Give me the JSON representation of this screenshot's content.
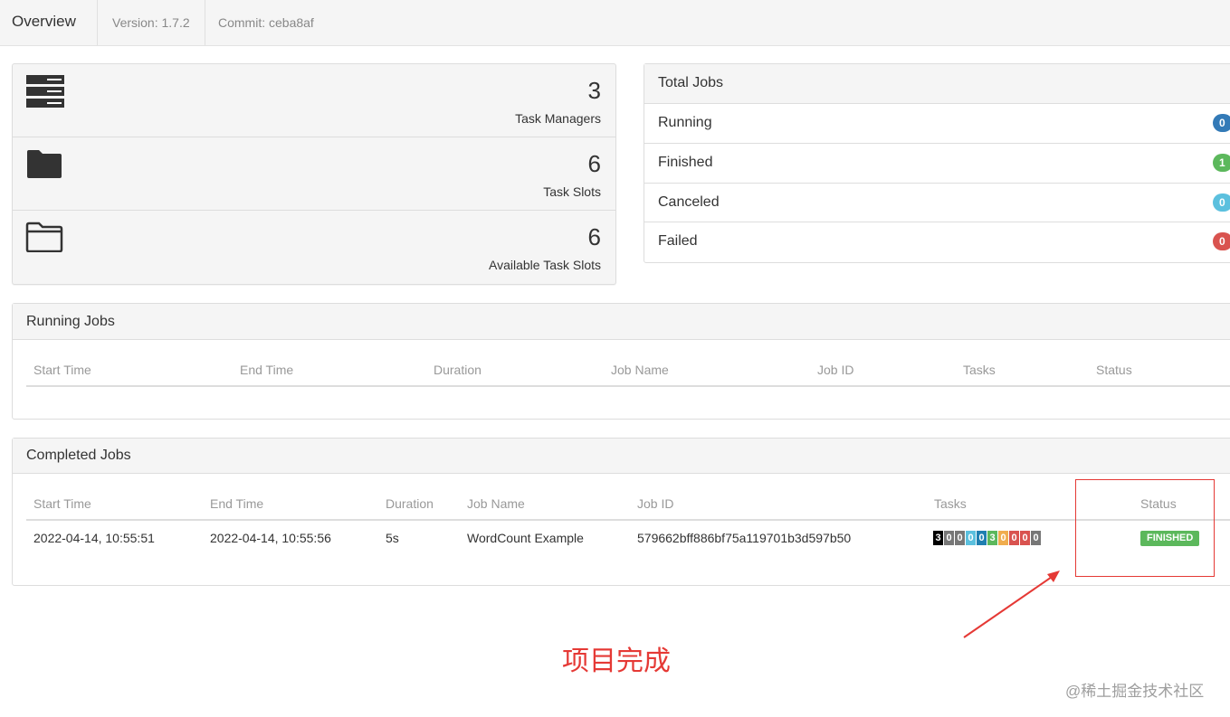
{
  "topbar": {
    "title": "Overview",
    "version": "Version: 1.7.2",
    "commit": "Commit: ceba8af"
  },
  "stats": [
    {
      "icon": "server-icon",
      "value": "3",
      "label": "Task Managers"
    },
    {
      "icon": "folder-filled-icon",
      "value": "6",
      "label": "Task Slots"
    },
    {
      "icon": "folder-open-icon",
      "value": "6",
      "label": "Available Task Slots"
    }
  ],
  "total_jobs": {
    "title": "Total Jobs",
    "rows": [
      {
        "label": "Running",
        "count": "0",
        "color": "#337ab7"
      },
      {
        "label": "Finished",
        "count": "1",
        "color": "#5cb85c"
      },
      {
        "label": "Canceled",
        "count": "0",
        "color": "#5bc0de"
      },
      {
        "label": "Failed",
        "count": "0",
        "color": "#d9534f"
      }
    ]
  },
  "running_jobs": {
    "title": "Running Jobs",
    "columns": [
      "Start Time",
      "End Time",
      "Duration",
      "Job Name",
      "Job ID",
      "Tasks",
      "Status"
    ]
  },
  "completed_jobs": {
    "title": "Completed Jobs",
    "columns": [
      "Start Time",
      "End Time",
      "Duration",
      "Job Name",
      "Job ID",
      "Tasks",
      "Status"
    ],
    "rows": [
      {
        "start_time": "2022-04-14, 10:55:51",
        "end_time": "2022-04-14, 10:55:56",
        "duration": "5s",
        "job_name": "WordCount Example",
        "job_id": "579662bff886bf75a119701b3d597b50",
        "tasks": [
          {
            "value": "3",
            "color": "#000000"
          },
          {
            "value": "0",
            "color": "#777777"
          },
          {
            "value": "0",
            "color": "#777777"
          },
          {
            "value": "0",
            "color": "#5bc0de"
          },
          {
            "value": "0",
            "color": "#1f7fb0"
          },
          {
            "value": "3",
            "color": "#5cb85c"
          },
          {
            "value": "0",
            "color": "#f0ad4e"
          },
          {
            "value": "0",
            "color": "#d9534f"
          },
          {
            "value": "0",
            "color": "#d9534f"
          },
          {
            "value": "0",
            "color": "#777777"
          }
        ],
        "status": "FINISHED",
        "status_color": "#5cb85c"
      }
    ]
  },
  "annotation": {
    "text": "项目完成",
    "color": "#e53935"
  },
  "watermark": "@稀土掘金技术社区"
}
